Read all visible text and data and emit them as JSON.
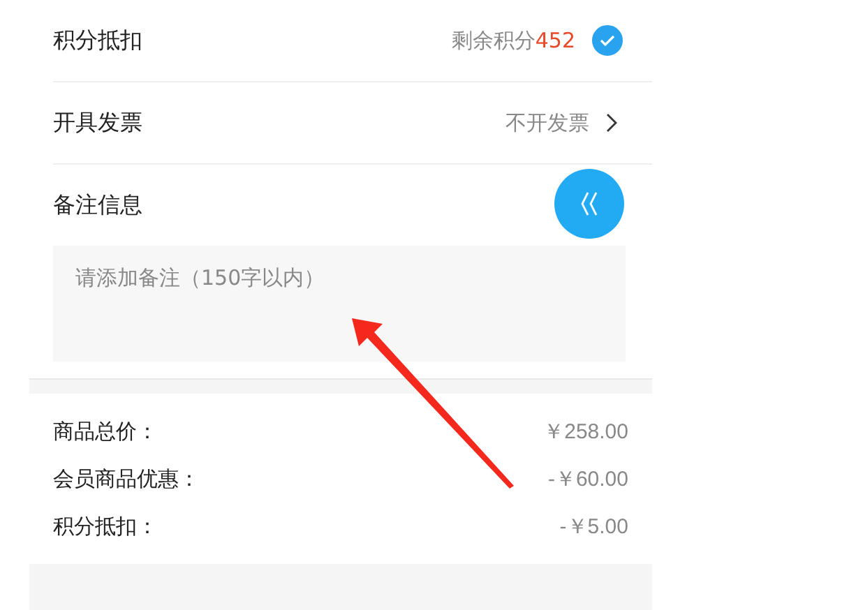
{
  "options": [
    {
      "kind": "points",
      "label": "积分抵扣",
      "hint": "剩余积分",
      "value": "452",
      "checked": true
    },
    {
      "kind": "link",
      "label": "开具发票",
      "value": "不开发票"
    }
  ],
  "remark": {
    "label": "备注信息",
    "placeholder": "请添加备注（150字以内）"
  },
  "summary": [
    {
      "label": "商品总价：",
      "value": "￥258.00"
    },
    {
      "label": "会员商品优惠：",
      "value": "-￥60.00"
    },
    {
      "label": "积分抵扣：",
      "value": "-￥5.00"
    }
  ]
}
